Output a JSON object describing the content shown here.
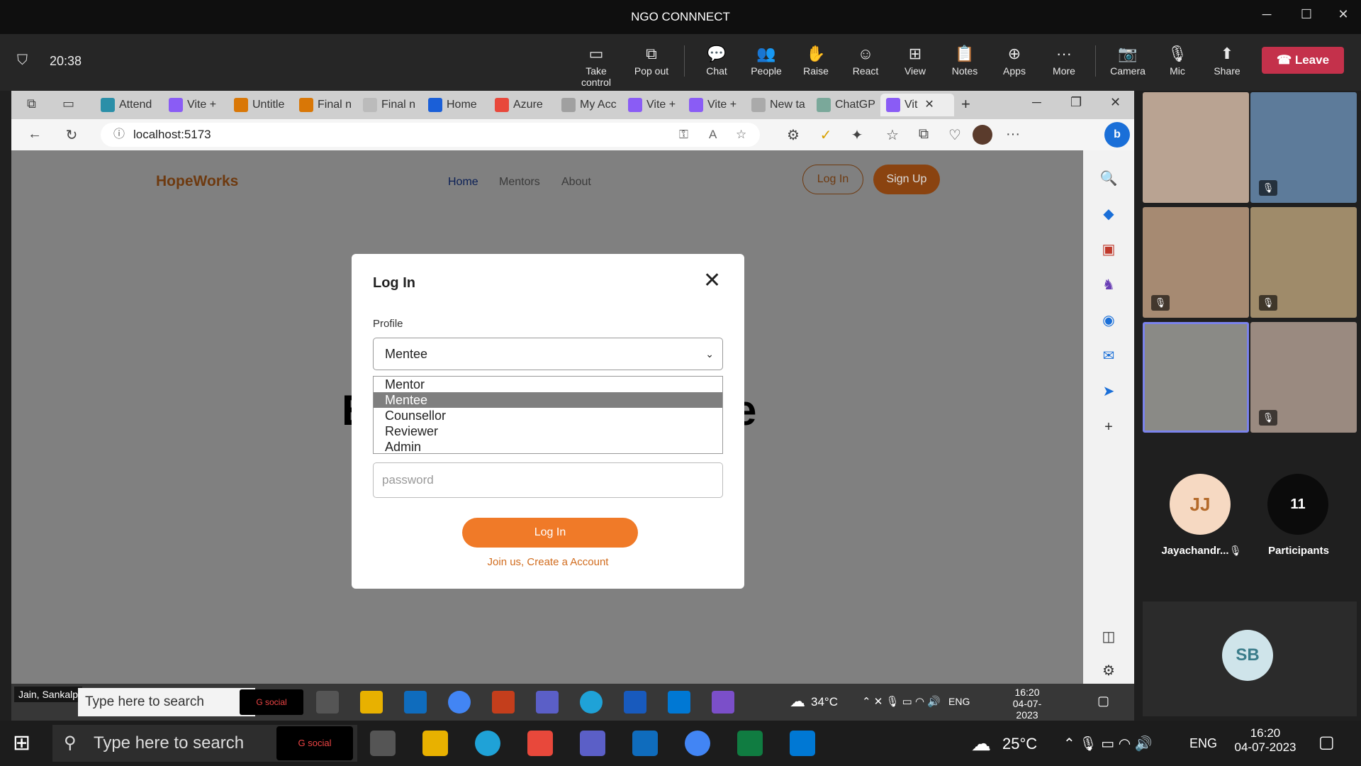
{
  "window": {
    "title": "NGO CONNNECT"
  },
  "meeting": {
    "timer": "20:38",
    "toolbar": [
      "Take control",
      "Pop out",
      "Chat",
      "People",
      "Raise",
      "React",
      "View",
      "Notes",
      "Apps",
      "More",
      "Camera",
      "Mic",
      "Share"
    ],
    "leave": "Leave"
  },
  "browser": {
    "tabs": [
      "Attend",
      "Vite +",
      "Untitle",
      "Final n",
      "Final n",
      "Home",
      "Azure",
      "My Acc",
      "Vite +",
      "Vite +",
      "New ta",
      "ChatGP",
      "Vit"
    ],
    "url": "localhost:5173"
  },
  "site": {
    "brand": "HopeWorks",
    "nav": [
      "Home",
      "Mentors",
      "About"
    ],
    "login": "Log In",
    "signup": "Sign Up",
    "bg_word_left": "E",
    "bg_word_right": "e"
  },
  "modal": {
    "title": "Log In",
    "profile_label": "Profile",
    "selected": "Mentee",
    "options": [
      "Mentor",
      "Mentee",
      "Counsellor",
      "Reviewer",
      "Admin"
    ],
    "password_placeholder": "password",
    "login_button": "Log In",
    "join_link": "Join us, Create a Account"
  },
  "inner_taskbar": {
    "user": "Jain, Sankalp",
    "search": "Type here to search",
    "temp": "34°C",
    "lang": "ENG",
    "time": "16:20",
    "date": "04-07-2023"
  },
  "participants": {
    "avatars": [
      {
        "initials": "JJ",
        "name": "Jayachandr..."
      },
      {
        "initials": "11",
        "name": "Participants"
      }
    ],
    "sb": "SB"
  },
  "os_taskbar": {
    "search": "Type here to search",
    "temp": "25°C",
    "lang": "ENG",
    "time": "16:20",
    "date": "04-07-2023"
  }
}
